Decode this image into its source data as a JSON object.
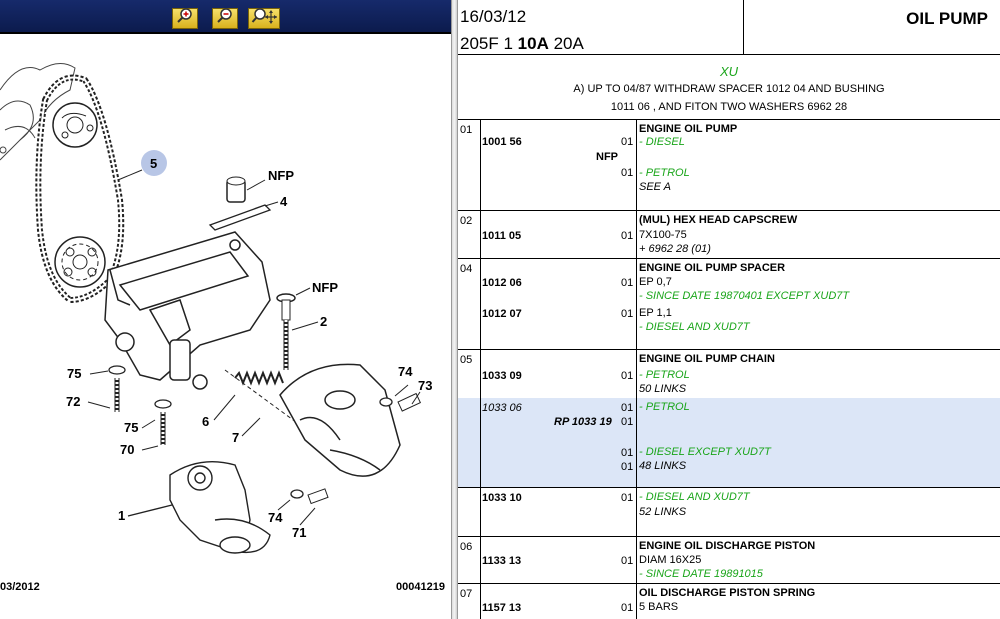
{
  "toolbar": {
    "buttons": [
      {
        "name": "zoom-in",
        "icon": "zoom-in-icon"
      },
      {
        "name": "zoom-out",
        "icon": "zoom-out-icon"
      },
      {
        "name": "zoom-pan",
        "icon": "zoom-pan-icon"
      }
    ]
  },
  "diagram": {
    "callouts": {
      "c5": "5",
      "nfp1": "NFP",
      "c4": "4",
      "nfp2": "NFP",
      "c2": "2",
      "c75a": "75",
      "c74": "74",
      "c73": "73",
      "c72": "72",
      "c75b": "75",
      "c6": "6",
      "c7": "7",
      "c70": "70",
      "c1": "1",
      "c74b": "74",
      "c71": "71"
    },
    "footer_left": "03/2012",
    "footer_right": "00041219"
  },
  "header": {
    "date": "16/03/12",
    "model_prefix": "205F 1 ",
    "model_bold": "10A",
    "model_suffix": " 20A",
    "title": "OIL PUMP"
  },
  "engine": {
    "code": "XU",
    "note_line1": "A) UP TO 04/87 WITHDRAW SPACER 1012 04 AND BUSHING",
    "note_line2": "1011 06 , AND FITON TWO WASHERS 6962 28"
  },
  "groups": [
    {
      "index": "01",
      "rows": [
        {
          "ref": "1001 56",
          "qty": "01",
          "title": "ENGINE OIL PUMP",
          "note": "- DIESEL"
        },
        {
          "tag": "NFP"
        },
        {
          "qty": "01",
          "note": "- PETROL",
          "extra": "SEE A"
        }
      ]
    },
    {
      "index": "02",
      "rows": [
        {
          "ref": "1011 05",
          "qty": "01",
          "title": "(MUL) HEX HEAD CAPSCREW",
          "desc": "7X100-75",
          "extra": "+ 6962 28 (01)"
        }
      ]
    },
    {
      "index": "04",
      "rows": [
        {
          "ref": "1012 06",
          "qty": "01",
          "title": "ENGINE OIL PUMP SPACER",
          "desc": "EP 0,7",
          "note": "- SINCE DATE 19870401 EXCEPT XUD7T"
        },
        {
          "ref": "1012 07",
          "qty": "01",
          "desc": "EP 1,1",
          "note": "- DIESEL AND XUD7T"
        }
      ]
    },
    {
      "index": "05",
      "rows": [
        {
          "ref": "1033 09",
          "qty": "01",
          "title": "ENGINE OIL PUMP CHAIN",
          "note": "- PETROL",
          "extra": "50 LINKS"
        }
      ]
    },
    {
      "highlight": true,
      "rows": [
        {
          "ref": "1033 06",
          "qty": "01",
          "note": "- PETROL"
        },
        {
          "rp": "RP 1033 19",
          "qty": "01"
        },
        {
          "qty": "01",
          "note": "- DIESEL EXCEPT XUD7T"
        },
        {
          "qty": "01",
          "extra": "48 LINKS"
        }
      ]
    },
    {
      "rows": [
        {
          "ref": "1033 10",
          "qty": "01",
          "note": "- DIESEL AND XUD7T",
          "extra": "52 LINKS"
        }
      ]
    },
    {
      "index": "06",
      "rows": [
        {
          "ref": "1133 13",
          "qty": "01",
          "title": "ENGINE OIL DISCHARGE PISTON",
          "desc": "DIAM 16X25",
          "note": "- SINCE DATE 19891015"
        }
      ]
    },
    {
      "index": "07",
      "rows": [
        {
          "ref": "1157 13",
          "qty": "01",
          "title": "OIL DISCHARGE PISTON SPRING",
          "desc": "5 BARS"
        }
      ]
    }
  ]
}
